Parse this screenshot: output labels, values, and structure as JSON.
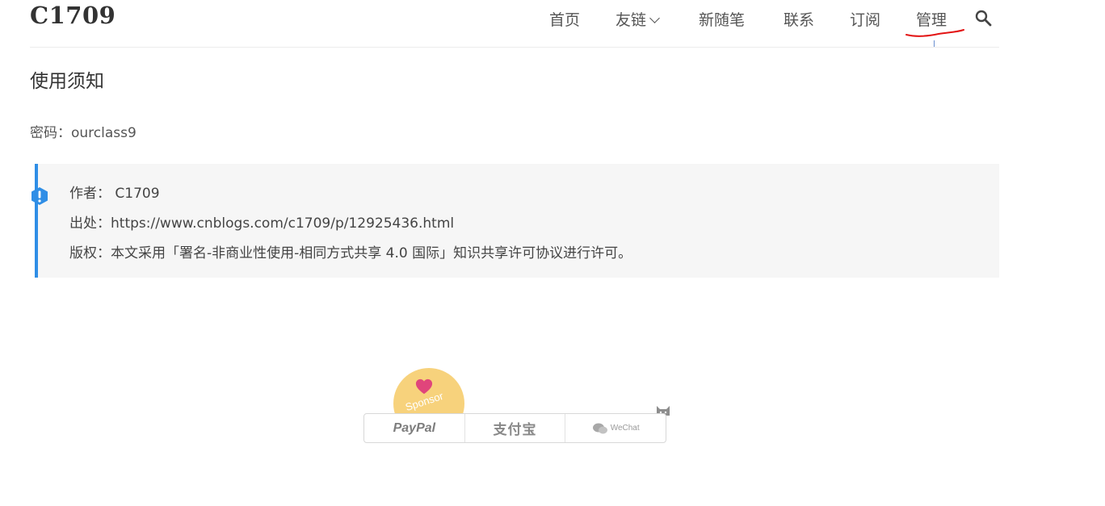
{
  "site": {
    "title": "C1709"
  },
  "nav": {
    "items": [
      {
        "label": "首页"
      },
      {
        "label": "友链"
      },
      {
        "label": "新随笔"
      },
      {
        "label": "联系"
      },
      {
        "label": "订阅"
      },
      {
        "label": "管理"
      }
    ],
    "search_icon": "search-icon"
  },
  "post": {
    "title": "使用须知",
    "password": "密码：ourclass9"
  },
  "info": {
    "author": "作者： C1709",
    "source": "出处：https://www.cnblogs.com/c1709/p/12925436.html",
    "license": "版权：本文采用「署名-非商业性使用-相同方式共享 4.0 国际」知识共享许可协议进行许可。",
    "accent_color": "#2f8ee6"
  },
  "sponsor": {
    "badge_text": "Sponsor",
    "paypal": "PayPal",
    "alipay": "支付宝",
    "wechat": "WeChat",
    "badge_color": "#f7d27c"
  }
}
